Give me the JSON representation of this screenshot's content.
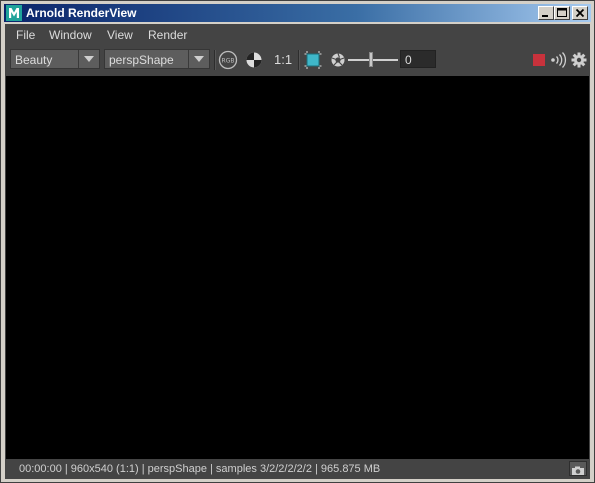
{
  "window": {
    "title": "Arnold RenderView",
    "app_icon": "maya-m-icon",
    "controls": [
      "minimize-icon",
      "maximize-icon",
      "close-icon"
    ]
  },
  "menu": {
    "items": [
      "File",
      "Window",
      "View",
      "Render"
    ]
  },
  "toolbar": {
    "aov_select": "Beauty",
    "camera_select": "perspShape",
    "rgb_label": "RGB",
    "ratio_label": "1:1",
    "exposure_value": "0",
    "icons": [
      "rgb-channel-icon",
      "alpha-checker-icon",
      "crop-region-icon",
      "aperture-icon",
      "stop-render-icon",
      "live-update-icon",
      "settings-gear-icon"
    ],
    "stop_color": "#c8323c",
    "crop_color": "#3fb7c9",
    "exposure_level": 0.45
  },
  "status": {
    "text": "00:00:00 | 960x540 (1:1) | perspShape  | samples 3/2/2/2/2/2 | 965.875 MB",
    "snapshot_icon": "camera-icon"
  },
  "colors": {
    "titlebar_start": "#0a246a",
    "titlebar_end": "#a6caf0",
    "panel": "#444444",
    "viewport": "#000000"
  }
}
